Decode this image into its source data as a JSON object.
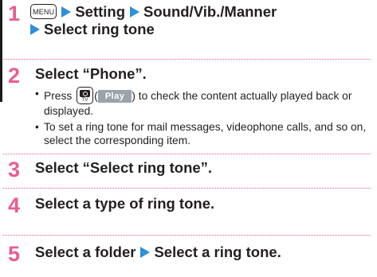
{
  "accent_color": "#ea5c93",
  "arrow_color": "#2f8fd8",
  "step1": {
    "number": "1",
    "menu_key": "MENU",
    "items": [
      "Setting",
      "Sound/Vib./Manner",
      "Select ring tone"
    ]
  },
  "step2": {
    "number": "2",
    "title": "Select “Phone”.",
    "bullets": {
      "b1_pre": "Press ",
      "camera_key_icon": "camera-tv-key-icon",
      "camera_key_label": "TV",
      "paren_open": "(",
      "play_label": "Play",
      "b1_post": ") to check the content actually played back or displayed.",
      "b2": "To set a ring tone for mail messages, videophone calls, and so on, select the corresponding item."
    }
  },
  "step3": {
    "number": "3",
    "title": "Select “Select ring tone”."
  },
  "step4": {
    "number": "4",
    "title": "Select a type of ring tone."
  },
  "step5": {
    "number": "5",
    "items": [
      "Select a folder",
      "Select a ring tone."
    ]
  }
}
